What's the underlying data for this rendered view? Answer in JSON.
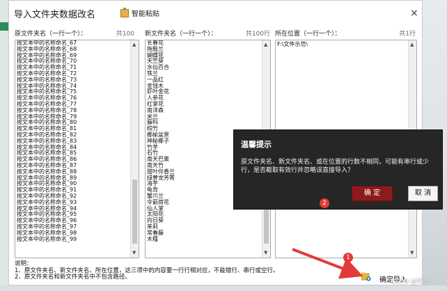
{
  "window": {
    "title": "导入文件夹数据改名",
    "paste_label": "智能粘贴",
    "close": "×"
  },
  "columns": [
    {
      "label": "原文件夹名（一行一个）：",
      "count": "共100行"
    },
    {
      "label": "新文件夹名（一行一个）：",
      "count": "共100行"
    },
    {
      "label": "所在位置（一行一个）：",
      "count": "共1行"
    }
  ],
  "original_names": [
    "按文本中的名称命名_67",
    "按文本中的名称命名_68",
    "按文本中的名称命名_69",
    "按文本中的名称命名_70",
    "按文本中的名称命名_71",
    "按文本中的名称命名_72",
    "按文本中的名称命名_73",
    "按文本中的名称命名_74",
    "按文本中的名称命名_75",
    "按文本中的名称命名_76",
    "按文本中的名称命名_77",
    "按文本中的名称命名_78",
    "按文本中的名称命名_79",
    "按文本中的名称命名_80",
    "按文本中的名称命名_81",
    "按文本中的名称命名_82",
    "按文本中的名称命名_83",
    "按文本中的名称命名_84",
    "按文本中的名称命名_85",
    "按文本中的名称命名_86",
    "按文本中的名称命名_87",
    "按文本中的名称命名_88",
    "按文本中的名称命名_89",
    "按文本中的名称命名_90",
    "按文本中的名称命名_91",
    "按文本中的名称命名_92",
    "按文本中的名称命名_93",
    "按文本中的名称命名_94",
    "按文本中的名称命名_95",
    "按文本中的名称命名_96",
    "按文本中的名称命名_97",
    "按文本中的名称命名_98",
    "按文本中的名称命名_99"
  ],
  "new_names": [
    "长春花",
    "拖鞋兰",
    "蝴蝶花",
    "天竺葵",
    "水仙百合",
    "铁兰",
    "一品红",
    "金钱木",
    "虾叶金花",
    "人参花",
    "红掌花",
    "南洋森",
    "米兰",
    "藤科",
    "棕竹",
    "榔榆盆景",
    "神秘椰子",
    "竹芋",
    "石竹",
    "南天巴栗",
    "南天竹",
    "甜叶伴香兰",
    "绿萝龙芳菁",
    "海芋",
    "龟背",
    "蟹爪兰",
    "令箭荷花",
    "仙人掌",
    "太阳花",
    "向日葵",
    "茉莉",
    "常春藤",
    "木槿"
  ],
  "locations": [
    "F:\\文件示范\\"
  ],
  "notes": [
    "说明：",
    "1、原文件夹名、新文件夹名、所在位置，这三项中的内容要一行行相对应，不能错行、串行或空行。",
    "2、原文件夹名和新文件夹名中不包含路径。"
  ],
  "confirm_import": "确定导入",
  "dialog": {
    "title": "温馨提示",
    "message": "原文件夹名、新文件夹名、或在位置的行数不相同，可能有串行或少行，是否截取有效行并忽略误直接导入？",
    "ok": "确 定",
    "cancel": "取 消"
  },
  "markers": [
    "1",
    "2"
  ],
  "watermark": "CSDN @叩心",
  "colors": {
    "ok_button": "#8e1b1b",
    "dialog_bg": "#262626",
    "marker": "#e23b3b"
  }
}
